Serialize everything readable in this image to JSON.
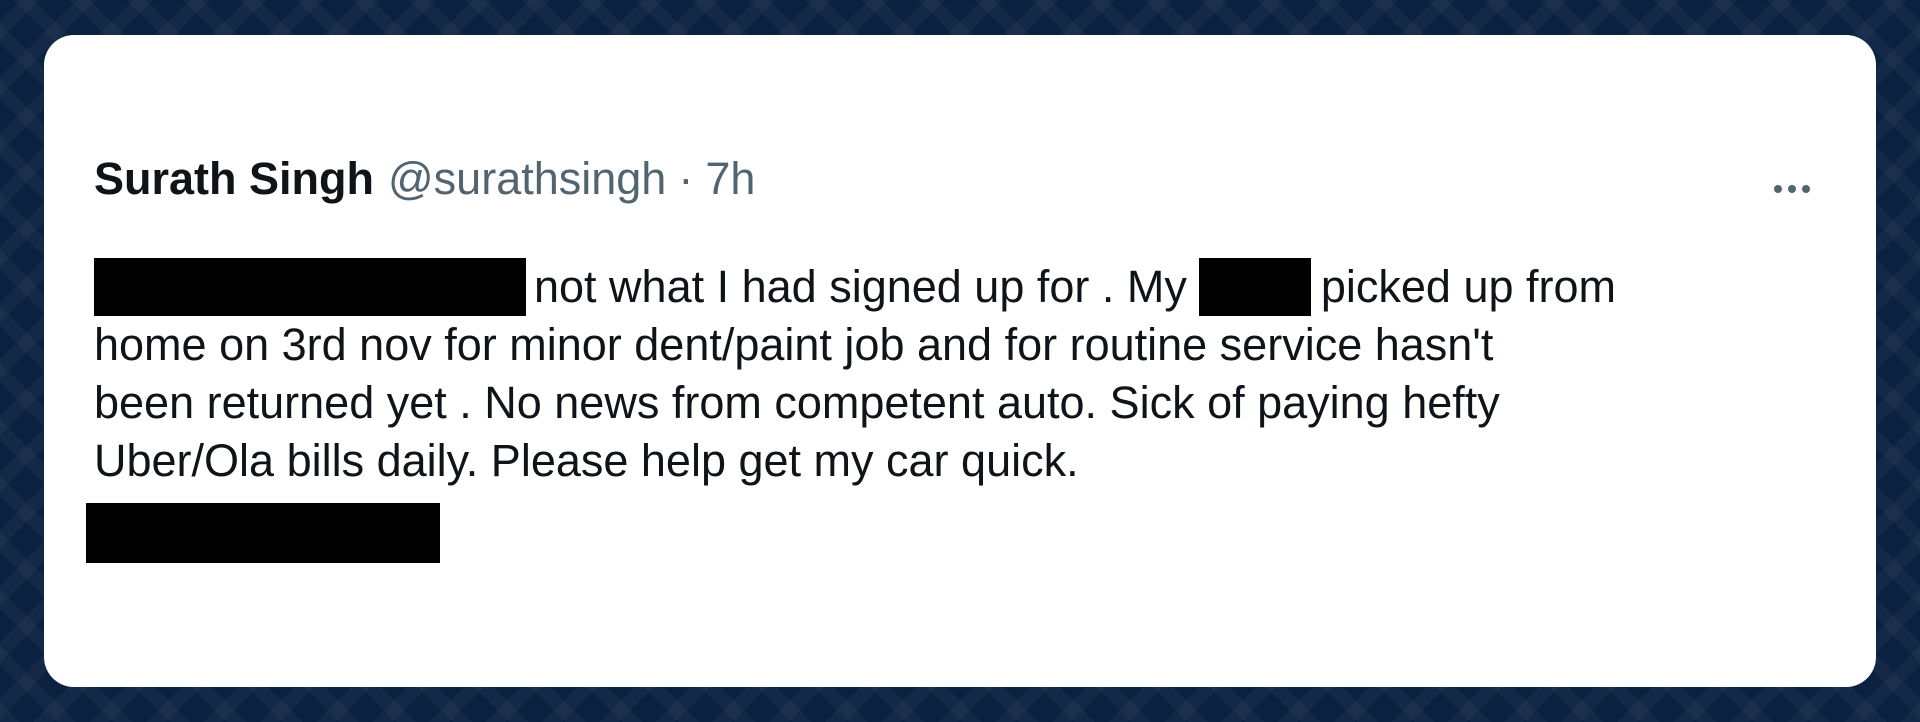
{
  "tweet": {
    "author_name": "Surath Singh",
    "author_handle": "@surathsingh",
    "separator": "·",
    "timestamp": "7h",
    "more_icon": "more-horizontal-icon",
    "body": {
      "line1_after_redaction": "not what I had signed up for . My",
      "line1_end": "picked up from",
      "line2": "home on 3rd nov for minor dent/paint job and for routine service hasn't",
      "line3": "been returned yet . No news from competent auto. Sick of paying hefty",
      "line4": "Uber/Ola bills daily. Please help get my car quick."
    }
  },
  "colors": {
    "background": "#0b2140",
    "card": "#ffffff",
    "primary_text": "#0f1419",
    "secondary_text": "#536471",
    "redaction": "#000000"
  }
}
